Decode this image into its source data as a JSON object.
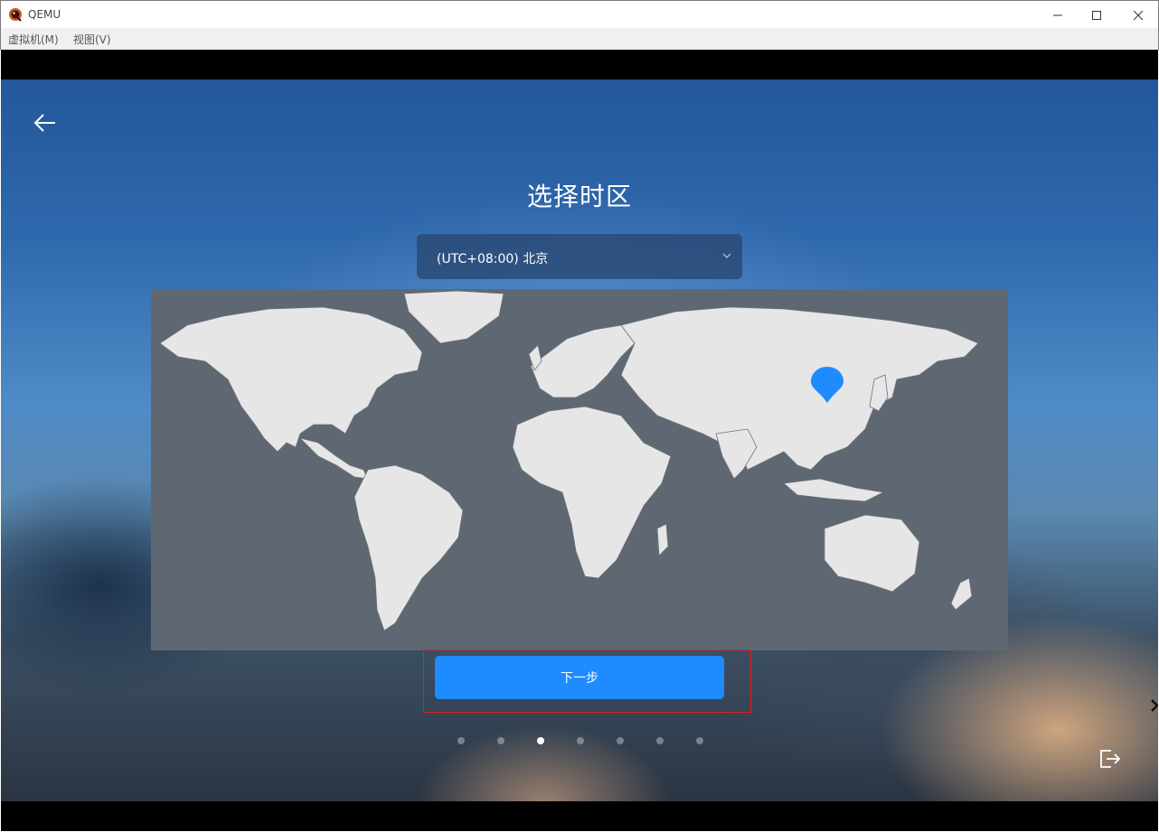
{
  "window": {
    "title": "QEMU",
    "controls": [
      "minimize",
      "maximize",
      "close"
    ]
  },
  "menubar": {
    "items": [
      {
        "label": "虚拟机(M)"
      },
      {
        "label": "视图(V)"
      }
    ]
  },
  "installer": {
    "title": "选择时区",
    "timezone_select": {
      "value": "(UTC+08:00) 北京"
    },
    "map": {
      "selected_city": "北京",
      "marker_color": "#1e8cff"
    },
    "next_button": {
      "label": "下一步",
      "highlighted": true
    },
    "pagination": {
      "total": 7,
      "current_index": 2
    },
    "icons": {
      "back": "back-arrow-icon",
      "exit": "exit-icon",
      "side": "chevron-right-icon"
    },
    "colors": {
      "accent": "#1e8cff",
      "highlight_box": "#e02020"
    }
  }
}
